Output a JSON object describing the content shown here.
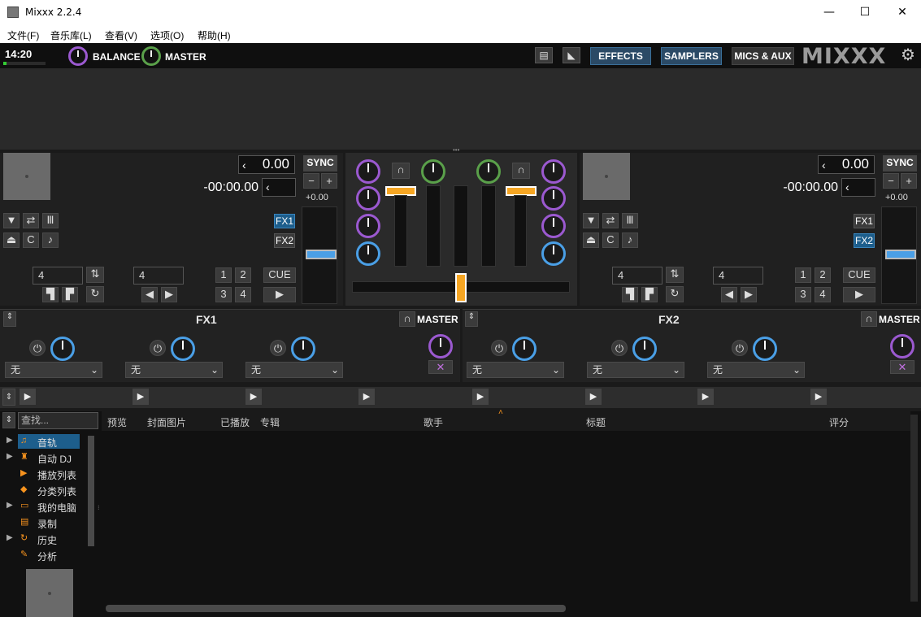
{
  "window": {
    "title": "Mixxx 2.2.4",
    "min": "—",
    "max": "☐",
    "close": "✕"
  },
  "menu": [
    "文件(F)",
    "音乐库(L)",
    "查看(V)",
    "选项(O)",
    "帮助(H)"
  ],
  "toolbar": {
    "clock": "14:20",
    "balance": "BALANCE",
    "master": "MASTER",
    "effects": "EFFECTS",
    "samplers": "SAMPLERS",
    "mics": "MICS & AUX",
    "logo": "MIXXX"
  },
  "deck1": {
    "pos": "0.00",
    "remain": "-00:00.00",
    "sync": "SYNC",
    "rate": "+0.00",
    "fx1": "FX1",
    "fx2": "FX2",
    "beatjump": "4",
    "loop": "4",
    "cue": "CUE",
    "hotcues": [
      "1",
      "2",
      "3",
      "4"
    ]
  },
  "deck2": {
    "pos": "0.00",
    "remain": "-00:00.00",
    "sync": "SYNC",
    "rate": "+0.00",
    "fx1": "FX1",
    "fx2": "FX2",
    "beatjump": "4",
    "loop": "4",
    "cue": "CUE",
    "hotcues": [
      "1",
      "2",
      "3",
      "4"
    ]
  },
  "fx": [
    {
      "title": "FX1",
      "master": "MASTER",
      "slots": [
        "无",
        "无",
        "无"
      ]
    },
    {
      "title": "FX2",
      "master": "MASTER",
      "slots": [
        "无",
        "无",
        "无"
      ]
    }
  ],
  "library": {
    "search_placeholder": "查找...",
    "columns": [
      "预览",
      "封面图片",
      "已播放",
      "专辑",
      "歌手",
      "标题",
      "评分"
    ],
    "tree": [
      {
        "label": "音轨",
        "icon": "♫"
      },
      {
        "label": "自动 DJ",
        "icon": "♜"
      },
      {
        "label": "播放列表",
        "icon": "▶"
      },
      {
        "label": "分类列表",
        "icon": "◆"
      },
      {
        "label": "我的电脑",
        "icon": "▭"
      },
      {
        "label": "录制",
        "icon": "▤"
      },
      {
        "label": "历史",
        "icon": "↻"
      },
      {
        "label": "分析",
        "icon": "✎"
      }
    ]
  },
  "colors": {
    "accent": "#1d5e8c",
    "gain": "#f6a623"
  }
}
